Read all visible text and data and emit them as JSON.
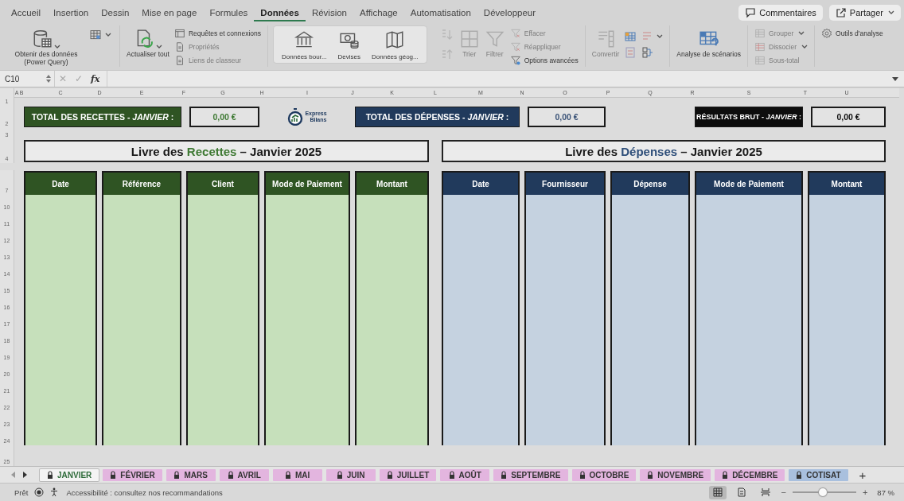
{
  "menu_tabs": [
    {
      "label": "Accueil",
      "selected": false
    },
    {
      "label": "Insertion",
      "selected": false
    },
    {
      "label": "Dessin",
      "selected": false
    },
    {
      "label": "Mise en page",
      "selected": false
    },
    {
      "label": "Formules",
      "selected": false
    },
    {
      "label": "Données",
      "selected": true
    },
    {
      "label": "Révision",
      "selected": false
    },
    {
      "label": "Affichage",
      "selected": false
    },
    {
      "label": "Automatisation",
      "selected": false
    },
    {
      "label": "Développeur",
      "selected": false
    }
  ],
  "header_buttons": [
    {
      "kind": "comments",
      "label": "Commentaires"
    },
    {
      "kind": "share",
      "label": "Partager"
    }
  ],
  "ribbon": [
    {
      "kind": "plain",
      "items": [
        {
          "kind": "large",
          "label": "Obtenir des données (Power Query)",
          "disabled": false
        },
        {
          "kind": "icon",
          "disabled": false
        }
      ]
    },
    {
      "kind": "plain",
      "items": [
        {
          "kind": "large",
          "label": "Actualiser tout",
          "disabled": false
        },
        {
          "kind": "stack",
          "entries": [
            {
              "label": "Requêtes et connexions",
              "disabled": false
            },
            {
              "label": "Propriétés",
              "disabled": true
            },
            {
              "label": "Liens de classeur",
              "disabled": true
            }
          ]
        }
      ]
    },
    {
      "kind": "gallery",
      "items": [
        {
          "kind": "large",
          "label": "Données bour...",
          "disabled": false
        },
        {
          "kind": "large",
          "label": "Devises",
          "disabled": false
        },
        {
          "kind": "large",
          "label": "Données géog...",
          "disabled": false
        }
      ]
    },
    {
      "kind": "plain",
      "items": [
        {
          "kind": "sort",
          "disabled": true
        },
        {
          "kind": "large",
          "label": "Trier",
          "disabled": true
        },
        {
          "kind": "large",
          "label": "Filtrer",
          "disabled": true
        },
        {
          "kind": "stack",
          "entries": [
            {
              "label": "Effacer",
              "disabled": true
            },
            {
              "label": "Réappliquer",
              "disabled": true
            },
            {
              "label": "Options avancées",
              "disabled": false
            }
          ]
        }
      ]
    },
    {
      "kind": "plain",
      "items": [
        {
          "kind": "large",
          "label": "Convertir",
          "disabled": true
        },
        {
          "kind": "icongrid"
        }
      ]
    },
    {
      "kind": "plain",
      "items": [
        {
          "kind": "large",
          "label": "Analyse de scénarios",
          "disabled": false
        }
      ]
    },
    {
      "kind": "plain",
      "items": [
        {
          "kind": "stack",
          "entries": [
            {
              "label": "Grouper",
              "disabled": true
            },
            {
              "label": "Dissocier",
              "disabled": true
            },
            {
              "label": "Sous-total",
              "disabled": true
            }
          ]
        }
      ]
    },
    {
      "kind": "plain",
      "items": [
        {
          "kind": "stack",
          "entries": [
            {
              "label": "Outils d'analyse",
              "disabled": false
            }
          ]
        }
      ]
    }
  ],
  "formula_bar": {
    "name_box": "C10",
    "cancel": "✕",
    "enter": "✓",
    "function": "fx"
  },
  "column_headers": [
    "A",
    "B",
    "C",
    "D",
    "E",
    "F",
    "G",
    "H",
    "I",
    "J",
    "K",
    "L",
    "M",
    "N",
    "O",
    "P",
    "Q",
    "R",
    "S",
    "T",
    "U"
  ],
  "row_headers": [
    "1",
    "2",
    "3",
    "4",
    "7",
    "10",
    "11",
    "12",
    "13",
    "14",
    "15",
    "16",
    "17",
    "18",
    "19",
    "20",
    "21",
    "22",
    "23",
    "24",
    "25"
  ],
  "summary": {
    "recettes_label": "TOTAL DES RECETTES - *JANVIER* :",
    "recettes_value": "0,00 €",
    "logo_line1": "Express",
    "logo_line2": "Bilans",
    "depenses_label": "TOTAL DES DÉPENSES - *JANVIER* :",
    "depenses_value": "0,00 €",
    "result_label": "RÉSULTATS BRUT - *JANVIER* :",
    "result_value": "0,00 €"
  },
  "recettes": {
    "title_before": "Livre des ",
    "title_accent": "Recettes",
    "title_after": " – Janvier 2025",
    "columns": [
      "Date",
      "Référence",
      "Client",
      "Mode de Paiement",
      "Montant"
    ]
  },
  "depenses": {
    "title_before": "Livre des ",
    "title_accent": "Dépenses",
    "title_after": " – Janvier 2025",
    "columns": [
      "Date",
      "Fournisseur",
      "Dépense",
      "Mode de Paiement",
      "Montant"
    ]
  },
  "sheet_tabs": [
    {
      "label": "JANVIER",
      "selected": true,
      "color": "#f4f4f4"
    },
    {
      "label": "FÉVRIER",
      "selected": false,
      "color": "#e3b5df"
    },
    {
      "label": "MARS",
      "selected": false,
      "color": "#e3b5df"
    },
    {
      "label": "AVRIL",
      "selected": false,
      "color": "#e3b5df"
    },
    {
      "label": "MAI",
      "selected": false,
      "color": "#e3b5df"
    },
    {
      "label": "JUIN",
      "selected": false,
      "color": "#e3b5df"
    },
    {
      "label": "JUILLET",
      "selected": false,
      "color": "#e3b5df"
    },
    {
      "label": "AOÛT",
      "selected": false,
      "color": "#e3b5df"
    },
    {
      "label": "SEPTEMBRE",
      "selected": false,
      "color": "#e3b5df"
    },
    {
      "label": "OCTOBRE",
      "selected": false,
      "color": "#e3b5df"
    },
    {
      "label": "NOVEMBRE",
      "selected": false,
      "color": "#e3b5df"
    },
    {
      "label": "DÉCEMBRE",
      "selected": false,
      "color": "#e3b5df"
    },
    {
      "label": "COTISAT",
      "selected": false,
      "color": "#a9c0de"
    }
  ],
  "add_sheet": "+",
  "status_bar": {
    "status": "Prêt",
    "accessibility": "Accessibilité : consultez nos recommandations",
    "views": [
      {
        "selected": true
      },
      {
        "selected": false
      },
      {
        "selected": false
      }
    ],
    "zoom_minus": "−",
    "zoom_plus": "+",
    "zoom": {
      "level": 0.48
    },
    "zoom_label": "87 %"
  }
}
